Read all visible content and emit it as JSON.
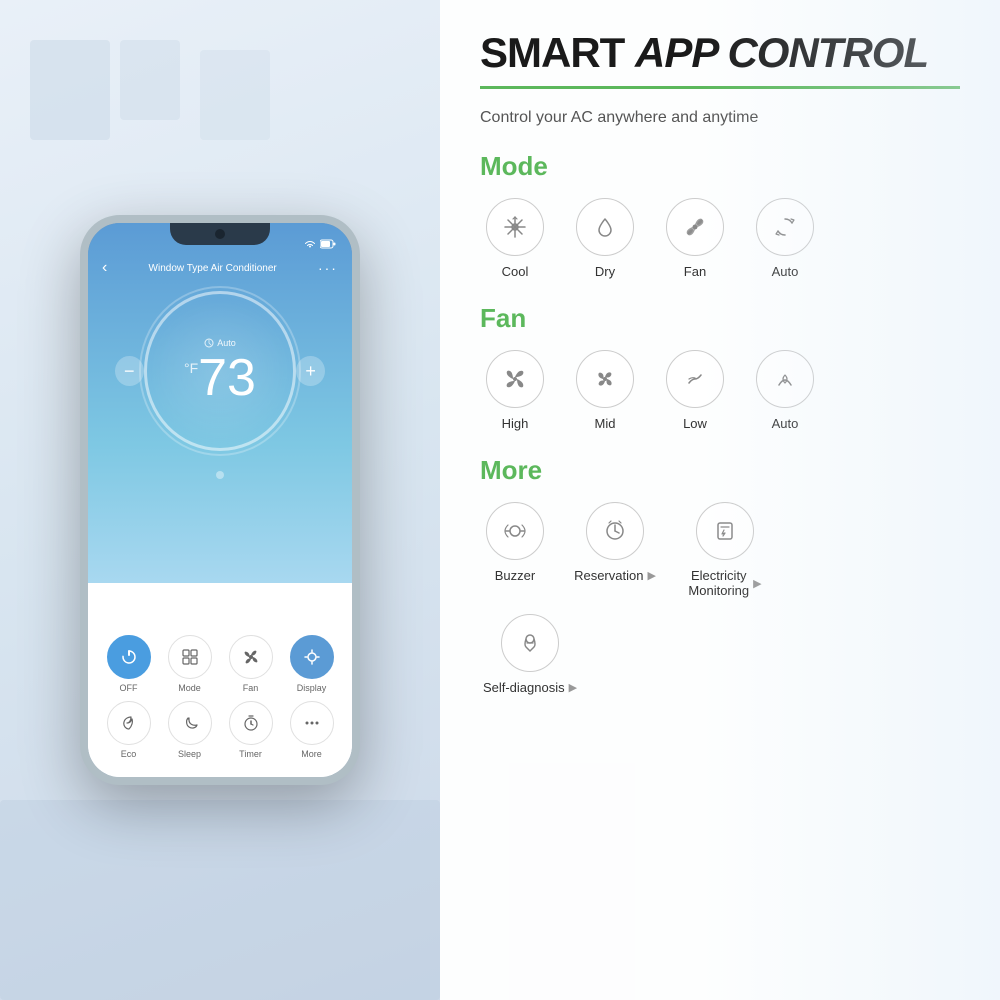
{
  "header": {
    "title_prefix": "SMART ",
    "title_bold": "APP CONTROL",
    "subtitle": "Control your AC anywhere and anytime"
  },
  "phone": {
    "app_title": "Window Type Air Conditioner",
    "mode": "Auto",
    "temperature": "73",
    "temp_unit": "°F",
    "bottom_buttons": [
      {
        "icon": "power",
        "label": "OFF",
        "active": true
      },
      {
        "icon": "mode",
        "label": "Mode",
        "active": false
      },
      {
        "icon": "fan",
        "label": "Fan",
        "active": false
      },
      {
        "icon": "display",
        "label": "Display",
        "active": true
      }
    ],
    "bottom_buttons2": [
      {
        "icon": "eco",
        "label": "Eco",
        "active": false
      },
      {
        "icon": "sleep",
        "label": "Sleep",
        "active": false
      },
      {
        "icon": "timer",
        "label": "Timer",
        "active": false
      },
      {
        "icon": "more",
        "label": "More",
        "active": false
      }
    ]
  },
  "modes": {
    "heading": "Mode",
    "items": [
      {
        "label": "Cool",
        "icon": "snowflake"
      },
      {
        "label": "Dry",
        "icon": "drop"
      },
      {
        "label": "Fan",
        "icon": "fan"
      },
      {
        "label": "Auto",
        "icon": "auto"
      }
    ]
  },
  "fan": {
    "heading": "Fan",
    "items": [
      {
        "label": "High",
        "icon": "fan-high"
      },
      {
        "label": "Mid",
        "icon": "fan-mid"
      },
      {
        "label": "Low",
        "icon": "fan-low"
      },
      {
        "label": "Auto",
        "icon": "fan-auto"
      }
    ]
  },
  "more": {
    "heading": "More",
    "items": [
      {
        "label": "Buzzer",
        "icon": "buzzer",
        "has_arrow": false
      },
      {
        "label": "Reservation",
        "icon": "reservation",
        "has_arrow": true
      },
      {
        "label": "Electricity\nMonitoring",
        "icon": "electricity",
        "has_arrow": true
      }
    ],
    "items2": [
      {
        "label": "Self-diagnosis",
        "icon": "diagnosis",
        "has_arrow": true
      }
    ]
  }
}
